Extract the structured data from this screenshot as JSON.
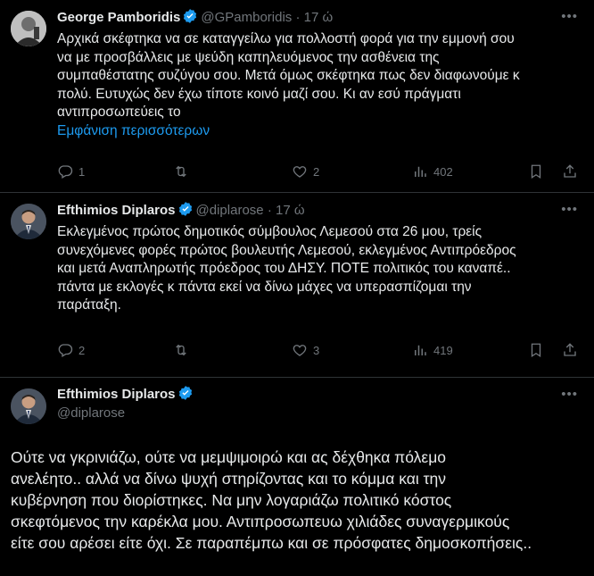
{
  "tweets": [
    {
      "name": "George Pamboridis",
      "handle": "@GPamboridis",
      "dot": "·",
      "time": "17 ώ",
      "lines": [
        "Αρχικά σκέφτηκα να σε καταγγείλω για πολλοστή φορά για την εμμονή σου",
        "να με προσβάλλεις με ψεύδη  καπηλευόμενος την ασθένεια της",
        "συμπαθέστατης συζύγου σου. Μετά όμως σκέφτηκα πως δεν διαφωνούμε κ",
        "πολύ. Ευτυχώς δεν έχω τίποτε κοινό μαζί σου. Κι αν εσύ πράγματι",
        "αντιπροσωπεύεις το"
      ],
      "show_more": "Εμφάνιση περισσότερων",
      "replies": "1",
      "reposts": "",
      "likes": "2",
      "views": "402"
    },
    {
      "name": "Efthimios Diplaros",
      "handle": "@diplarose",
      "dot": "·",
      "time": "17 ώ",
      "lines": [
        "Εκλεγμένος πρώτος δημοτικός σύμβουλος Λεμεσού στα 26 μου, τρείς",
        "συνεχόμενες φορές πρώτος βουλευτής Λεμεσού, εκλεγμένος Αντιπρόεδρος",
        "και μετά Αναπληρωτής πρόεδρος του ΔΗΣΥ. ΠΟΤΕ πολιτικός του καναπέ..",
        "πάντα με εκλογές κ πάντα εκεί να δίνω μάχες να υπερασπίζομαι την",
        "παράταξη."
      ],
      "replies": "2",
      "reposts": "",
      "likes": "3",
      "views": "419"
    },
    {
      "name": "Efthimios Diplaros",
      "handle": "@diplarose",
      "lines": [
        "Ούτε να γκρινιάζω, ούτε να μεμψιμοιρώ και ας δέχθηκα πόλεμο",
        "ανελέητο.. αλλά να δίνω ψυχή στηρίζοντας και το κόμμα και την",
        "κυβέρνηση που διορίστηκες. Να μην λογαριάζω πολιτικό κόστος",
        "σκεφτόμενος την καρέκλα μου. Αντιπροσωπευω χιλιάδες συναγερμικούς",
        "είτε σου αρέσει είτε όχι. Σε παραπέμπω και σε πρόσφατες δημοσκοπήσεις.."
      ]
    }
  ],
  "icons": {
    "more": "more-dots-icon",
    "verified": "verified-badge-icon",
    "reply": "reply-icon",
    "repost": "repost-icon",
    "like": "like-icon",
    "views": "views-icon",
    "bookmark": "bookmark-icon",
    "share": "share-icon"
  },
  "colors": {
    "background": "#000000",
    "text": "#e7e9ea",
    "muted": "#71767b",
    "link": "#1d9bf0",
    "verified": "#1d9bf0",
    "divider": "#2f3336"
  }
}
